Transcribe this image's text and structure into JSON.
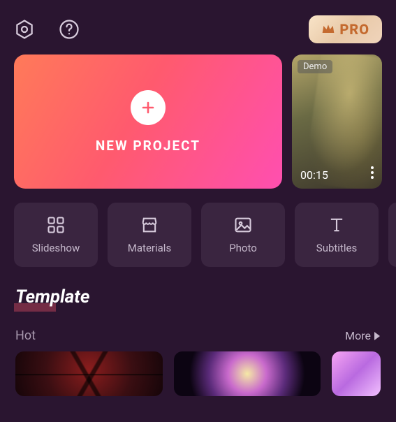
{
  "topbar": {
    "pro_label": "PRO"
  },
  "hero": {
    "new_project_label": "NEW PROJECT",
    "demo_tag": "Demo",
    "demo_duration": "00:15"
  },
  "tools": [
    {
      "label": "Slideshow"
    },
    {
      "label": "Materials"
    },
    {
      "label": "Photo"
    },
    {
      "label": "Subtitles"
    }
  ],
  "templates": {
    "section_title": "Template",
    "subhead": "Hot",
    "more_label": "More"
  }
}
